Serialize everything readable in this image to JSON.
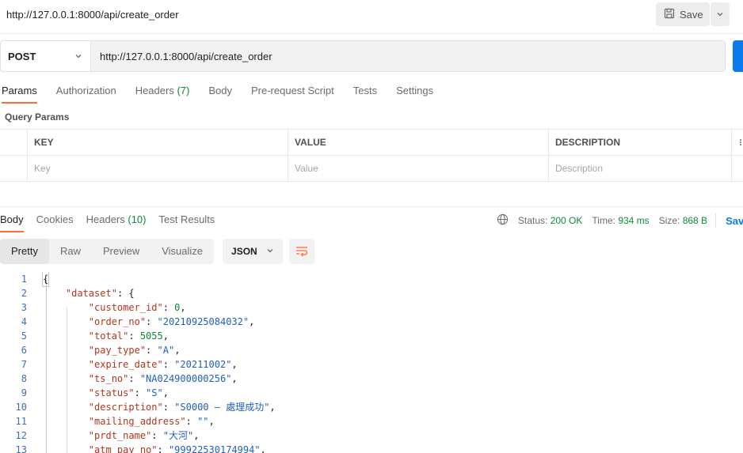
{
  "request": {
    "title": "http://127.0.0.1:8000/api/create_order",
    "save_label": "Save",
    "method": "POST",
    "url": "http://127.0.0.1:8000/api/create_order",
    "tabs": [
      {
        "label": "Params",
        "count": ""
      },
      {
        "label": "Authorization",
        "count": ""
      },
      {
        "label": "Headers",
        "count": "(7)"
      },
      {
        "label": "Body",
        "count": ""
      },
      {
        "label": "Pre-request Script",
        "count": ""
      },
      {
        "label": "Tests",
        "count": ""
      },
      {
        "label": "Settings",
        "count": ""
      }
    ],
    "query_params_title": "Query Params",
    "params_table": {
      "headers": [
        "KEY",
        "VALUE",
        "DESCRIPTION"
      ],
      "placeholders": [
        "Key",
        "Value",
        "Description"
      ]
    }
  },
  "response": {
    "tabs": [
      {
        "label": "Body",
        "count": ""
      },
      {
        "label": "Cookies",
        "count": ""
      },
      {
        "label": "Headers",
        "count": "(10)"
      },
      {
        "label": "Test Results",
        "count": ""
      }
    ],
    "status_label": "Status:",
    "status_value": "200 OK",
    "time_label": "Time:",
    "time_value": "934 ms",
    "size_label": "Size:",
    "size_value": "868 B",
    "save_label": "Save",
    "view_modes": [
      "Pretty",
      "Raw",
      "Preview",
      "Visualize"
    ],
    "format": "JSON",
    "lines": [
      {
        "n": "1",
        "indent": 0,
        "parts": [
          [
            "p",
            "{"
          ]
        ]
      },
      {
        "n": "2",
        "indent": 1,
        "parts": [
          [
            "k",
            "\"dataset\""
          ],
          [
            "p",
            ": {"
          ]
        ]
      },
      {
        "n": "3",
        "indent": 2,
        "parts": [
          [
            "k",
            "\"customer_id\""
          ],
          [
            "p",
            ": "
          ],
          [
            "n",
            "0"
          ],
          [
            "p",
            ","
          ]
        ]
      },
      {
        "n": "4",
        "indent": 2,
        "parts": [
          [
            "k",
            "\"order_no\""
          ],
          [
            "p",
            ": "
          ],
          [
            "s",
            "\"20210925084032\""
          ],
          [
            "p",
            ","
          ]
        ]
      },
      {
        "n": "5",
        "indent": 2,
        "parts": [
          [
            "k",
            "\"total\""
          ],
          [
            "p",
            ": "
          ],
          [
            "n",
            "5055"
          ],
          [
            "p",
            ","
          ]
        ]
      },
      {
        "n": "6",
        "indent": 2,
        "parts": [
          [
            "k",
            "\"pay_type\""
          ],
          [
            "p",
            ": "
          ],
          [
            "s",
            "\"A\""
          ],
          [
            "p",
            ","
          ]
        ]
      },
      {
        "n": "7",
        "indent": 2,
        "parts": [
          [
            "k",
            "\"expire_date\""
          ],
          [
            "p",
            ": "
          ],
          [
            "s",
            "\"20211002\""
          ],
          [
            "p",
            ","
          ]
        ]
      },
      {
        "n": "8",
        "indent": 2,
        "parts": [
          [
            "k",
            "\"ts_no\""
          ],
          [
            "p",
            ": "
          ],
          [
            "s",
            "\"NA024900000256\""
          ],
          [
            "p",
            ","
          ]
        ]
      },
      {
        "n": "9",
        "indent": 2,
        "parts": [
          [
            "k",
            "\"status\""
          ],
          [
            "p",
            ": "
          ],
          [
            "s",
            "\"S\""
          ],
          [
            "p",
            ","
          ]
        ]
      },
      {
        "n": "10",
        "indent": 2,
        "parts": [
          [
            "k",
            "\"description\""
          ],
          [
            "p",
            ": "
          ],
          [
            "s",
            "\"S0000 – 處理成功\""
          ],
          [
            "p",
            ","
          ]
        ]
      },
      {
        "n": "11",
        "indent": 2,
        "parts": [
          [
            "k",
            "\"mailing_address\""
          ],
          [
            "p",
            ": "
          ],
          [
            "s",
            "\"\""
          ],
          [
            "p",
            ","
          ]
        ]
      },
      {
        "n": "12",
        "indent": 2,
        "parts": [
          [
            "k",
            "\"prdt_name\""
          ],
          [
            "p",
            ": "
          ],
          [
            "s",
            "\"大河\""
          ],
          [
            "p",
            ","
          ]
        ]
      },
      {
        "n": "13",
        "indent": 2,
        "parts": [
          [
            "k",
            "\"atm_pay_no\""
          ],
          [
            "p",
            ": "
          ],
          [
            "s",
            "\"99922530174994\""
          ],
          [
            "p",
            ","
          ]
        ]
      }
    ]
  },
  "colors": {
    "accent": "#ff6c37",
    "send_button": "#097bed",
    "count_green": "#0b8a3a",
    "json_key": "#b1361e",
    "json_string": "#1f5fbf",
    "json_number": "#0b8a3a"
  },
  "icons": {
    "save": "floppy-disk-icon",
    "save_dropdown": "chevron-down-icon",
    "method_dropdown": "chevron-down-icon",
    "format_dropdown": "chevron-down-icon",
    "globe": "globe-icon",
    "wrap": "wrap-lines-icon"
  }
}
